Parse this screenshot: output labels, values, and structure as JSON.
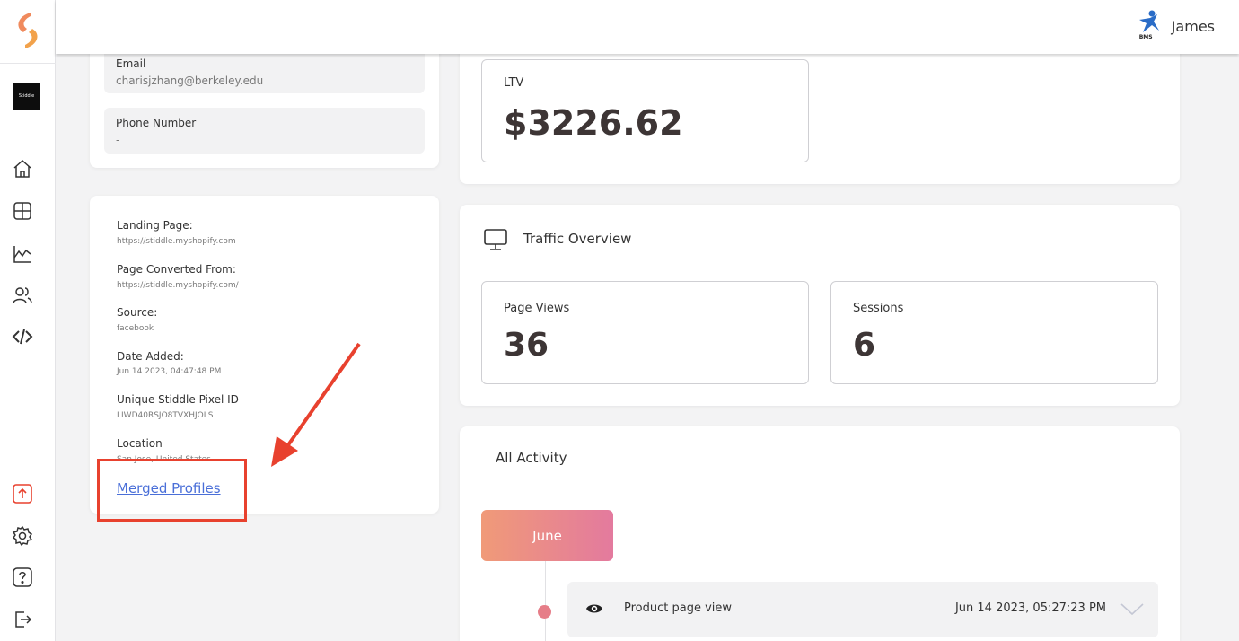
{
  "header": {
    "user_name": "James",
    "user_org": "BMS"
  },
  "sidebar": {
    "store_label": "Stiddle"
  },
  "contact": {
    "email_label": "Email",
    "email_value": "charisjzhang@berkeley.edu",
    "phone_label": "Phone Number",
    "phone_value": "-"
  },
  "details": {
    "landing_label": "Landing Page:",
    "landing_value": "https://stiddle.myshopify.com",
    "converted_label": "Page Converted From:",
    "converted_value": "https://stiddle.myshopify.com/",
    "source_label": "Source:",
    "source_value": "facebook",
    "date_label": "Date Added:",
    "date_value": "Jun 14 2023, 04:47:48 PM",
    "pixel_label": "Unique Stiddle Pixel ID",
    "pixel_value": "LIWD40RSJO8TVXHJOLS",
    "location_label": "Location",
    "location_value": "San Jose, United States",
    "merged_link": "Merged Profiles"
  },
  "ltv": {
    "label": "LTV",
    "value": "$3226.62"
  },
  "traffic": {
    "title": "Traffic Overview",
    "page_views_label": "Page Views",
    "page_views_value": "36",
    "sessions_label": "Sessions",
    "sessions_value": "6"
  },
  "activity": {
    "title": "All Activity",
    "month": "June",
    "items": [
      {
        "name": "Product page view",
        "time": "Jun 14 2023, 05:27:23 PM"
      }
    ]
  },
  "colors": {
    "accent_orange": "#f09a78",
    "accent_pink": "#e37a9e",
    "highlight_red": "#e8412e",
    "link_blue": "#4a6fd8"
  }
}
